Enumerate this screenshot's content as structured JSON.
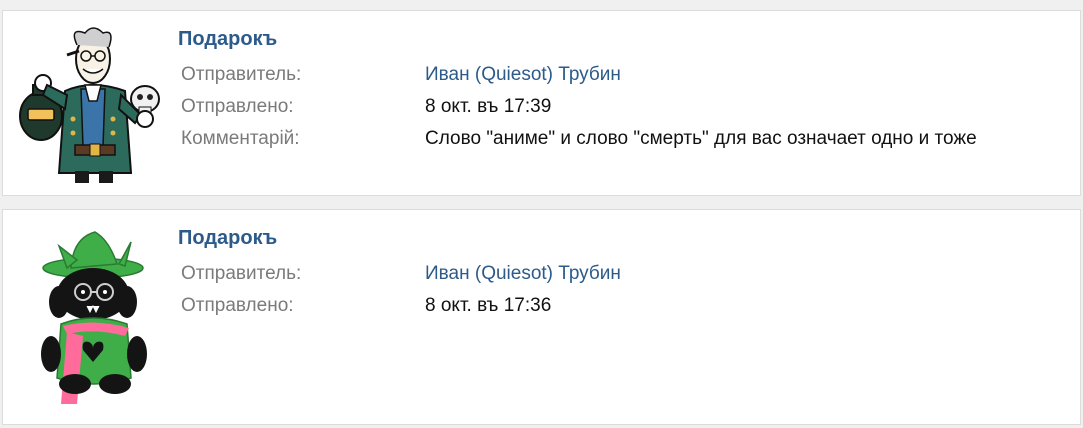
{
  "gifts": [
    {
      "image_icon": "pirate-skeleton-sticker",
      "title": "Подарокъ",
      "sender_label": "Отправитель:",
      "sender_name": "Иван (Quiesot) Трубин",
      "sent_label": "Отправлено:",
      "sent_value": "8 окт. въ 17:39",
      "comment_label": "Комментарій:",
      "comment_value": "Слово \"аниме\" и слово \"смерть\" для вас означает одно и тоже"
    },
    {
      "image_icon": "plush-toy-with-green-hat",
      "title": "Подарокъ",
      "sender_label": "Отправитель:",
      "sender_name": "Иван (Quiesot) Трубин",
      "sent_label": "Отправлено:",
      "sent_value": "8 окт. въ 17:36"
    }
  ],
  "colors": {
    "title": "#2c5b8a",
    "link": "#2c5b8a",
    "label": "#7a7a7a",
    "value": "#111111",
    "card_border": "#dcdcdc",
    "page_background": "#f0f0f0"
  }
}
